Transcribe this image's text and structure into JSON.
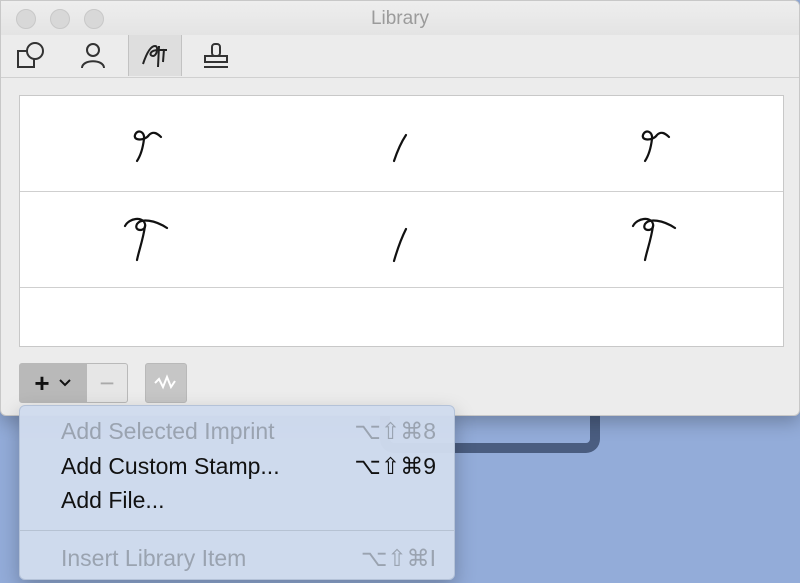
{
  "window": {
    "title": "Library"
  },
  "toolbar": {
    "tabs": [
      {
        "icon": "shapes-icon",
        "selected": false
      },
      {
        "icon": "person-icon",
        "selected": false
      },
      {
        "icon": "signature-icon",
        "selected": true
      },
      {
        "icon": "stamp-icon",
        "selected": false
      }
    ]
  },
  "library": {
    "rows": [
      {
        "items": [
          "signature-small",
          "signature-stroke",
          "signature-small"
        ]
      },
      {
        "items": [
          "signature-large",
          "signature-stroke",
          "signature-large"
        ]
      },
      {
        "items": []
      }
    ]
  },
  "bottombar": {
    "add_label": "+",
    "remove_label": "−"
  },
  "menu": {
    "items": [
      {
        "label": "Add Selected Imprint",
        "shortcut": "⌥⇧⌘8",
        "enabled": false
      },
      {
        "label": "Add Custom Stamp...",
        "shortcut": "⌥⇧⌘9",
        "enabled": true
      },
      {
        "label": "Add File...",
        "shortcut": "",
        "enabled": true
      },
      {
        "label": "Insert Library Item",
        "shortcut": "⌥⇧⌘I",
        "enabled": false
      }
    ]
  },
  "colors": {
    "desktop": "#93acd9",
    "menu_bg": "#cfdbed",
    "disabled_text": "#9aa3b0"
  }
}
